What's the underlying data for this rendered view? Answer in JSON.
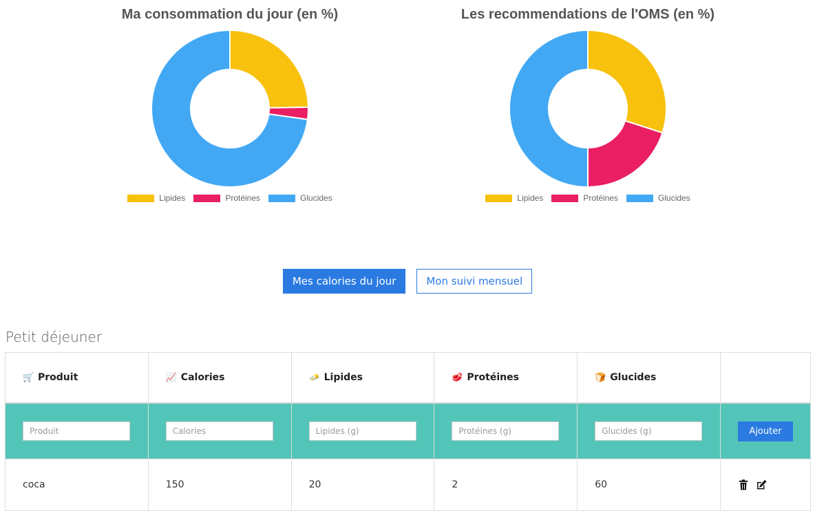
{
  "chart_data": [
    {
      "type": "pie",
      "title": "Ma consommation du jour (en %)",
      "categories": [
        "Lipides",
        "Protéines",
        "Glucides"
      ],
      "values": [
        24.7,
        2.5,
        72.8
      ],
      "colors": [
        "#f7c10d",
        "#e91e63",
        "#42a8f4"
      ],
      "donut": true,
      "legend_position": "bottom"
    },
    {
      "type": "pie",
      "title": "Les recommendations de l'OMS (en %)",
      "categories": [
        "Lipides",
        "Protéines",
        "Glucides"
      ],
      "values": [
        30,
        20,
        50
      ],
      "colors": [
        "#f7c10d",
        "#e91e63",
        "#42a8f4"
      ],
      "donut": true,
      "legend_position": "bottom"
    }
  ],
  "buttons": {
    "daily": "Mes calories du jour",
    "monthly": "Mon suivi mensuel"
  },
  "section": {
    "title": "Petit déjeuner"
  },
  "table": {
    "headers": [
      {
        "icon": "shopping-cart-icon",
        "label": "Produit"
      },
      {
        "icon": "chart-icon",
        "label": "Calories"
      },
      {
        "icon": "butter-icon",
        "label": "Lipides"
      },
      {
        "icon": "meat-icon",
        "label": "Protéines"
      },
      {
        "icon": "bread-icon",
        "label": "Glucides"
      }
    ],
    "placeholders": [
      "Produit",
      "Calories",
      "Lipides (g)",
      "Protéines (g)",
      "Glucides (g)"
    ],
    "add_label": "Ajouter",
    "rows": [
      {
        "produit": "coca",
        "calories": "150",
        "lipides": "20",
        "proteines": "2",
        "glucides": "60"
      }
    ],
    "input_row_color": "#53c5b8",
    "action_icons": [
      "trash-icon",
      "edit-icon"
    ]
  }
}
